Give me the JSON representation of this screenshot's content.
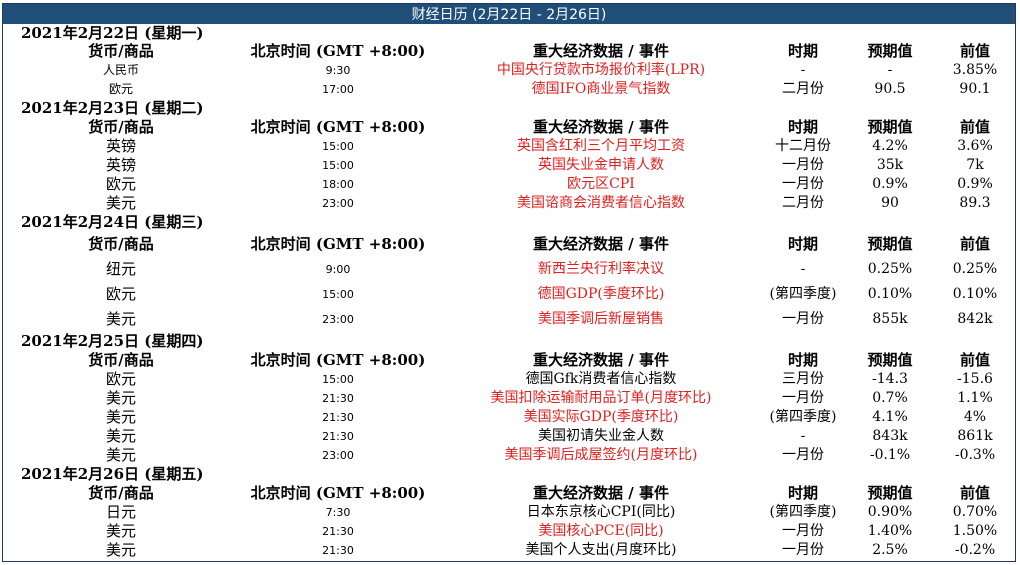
{
  "title": "财经日历 (2月22日 - 2月26日)",
  "headers": {
    "currency": "货币/商品",
    "time": "北京时间 (GMT +8:00)",
    "event": "重大经济数据 / 事件",
    "period": "时期",
    "forecast": "预期值",
    "previous": "前值"
  },
  "days": [
    {
      "date": "2021年2月22日 (星期一)",
      "rows": [
        {
          "currency": "人民币",
          "time": "9:30",
          "event": "中国央行贷款市场报价利率(LPR)",
          "period": "-",
          "forecast": "-",
          "previous": "3.85%",
          "highlight": true
        },
        {
          "currency": "欧元",
          "time": "17:00",
          "event": "德国IFO商业景气指数",
          "period": "二月份",
          "forecast": "90.5",
          "previous": "90.1",
          "highlight": true
        }
      ]
    },
    {
      "date": "2021年2月23日 (星期二)",
      "rows": [
        {
          "currency": "英镑",
          "time": "15:00",
          "event": "英国含红利三个月平均工资",
          "period": "十二月份",
          "forecast": "4.2%",
          "previous": "3.6%",
          "highlight": true
        },
        {
          "currency": "英镑",
          "time": "15:00",
          "event": "英国失业金申请人数",
          "period": "一月份",
          "forecast": "35k",
          "previous": "7k",
          "highlight": true
        },
        {
          "currency": "欧元",
          "time": "18:00",
          "event": "欧元区CPI",
          "period": "一月份",
          "forecast": "0.9%",
          "previous": "0.9%",
          "highlight": true
        },
        {
          "currency": "美元",
          "time": "23:00",
          "event": "美国谘商会消费者信心指数",
          "period": "二月份",
          "forecast": "90",
          "previous": "89.3",
          "highlight": true
        }
      ]
    },
    {
      "date": "2021年2月24日 (星期三)",
      "rows": [
        {
          "currency": "纽元",
          "time": "9:00",
          "event": "新西兰央行利率决议",
          "period": "-",
          "forecast": "0.25%",
          "previous": "0.25%",
          "highlight": true
        },
        {
          "currency": "欧元",
          "time": "15:00",
          "event": "德国GDP(季度环比)",
          "period": "(第四季度)",
          "forecast": "0.10%",
          "previous": "0.10%",
          "highlight": true
        },
        {
          "currency": "美元",
          "time": "23:00",
          "event": "美国季调后新屋销售",
          "period": "一月份",
          "forecast": "855k",
          "previous": "842k",
          "highlight": true
        }
      ]
    },
    {
      "date": "2021年2月25日 (星期四)",
      "rows": [
        {
          "currency": "欧元",
          "time": "15:00",
          "event": "德国Gfk消费者信心指数",
          "period": "三月份",
          "forecast": "-14.3",
          "previous": "-15.6",
          "highlight": false
        },
        {
          "currency": "美元",
          "time": "21:30",
          "event": "美国扣除运输耐用品订单(月度环比)",
          "period": "一月份",
          "forecast": "0.7%",
          "previous": "1.1%",
          "highlight": true
        },
        {
          "currency": "美元",
          "time": "21:30",
          "event": "美国实际GDP(季度环比)",
          "period": "(第四季度)",
          "forecast": "4.1%",
          "previous": "4%",
          "highlight": true
        },
        {
          "currency": "美元",
          "time": "21:30",
          "event": "美国初请失业金人数",
          "period": "-",
          "forecast": "843k",
          "previous": "861k",
          "highlight": false
        },
        {
          "currency": "美元",
          "time": "23:00",
          "event": "美国季调后成屋签约(月度环比)",
          "period": "一月份",
          "forecast": "-0.1%",
          "previous": "-0.3%",
          "highlight": true
        }
      ]
    },
    {
      "date": "2021年2月26日 (星期五)",
      "rows": [
        {
          "currency": "日元",
          "time": "7:30",
          "event": "日本东京核心CPI(同比)",
          "period": "(第四季度)",
          "forecast": "0.90%",
          "previous": "0.70%",
          "highlight": false
        },
        {
          "currency": "美元",
          "time": "21:30",
          "event": "美国核心PCE(同比)",
          "period": "一月份",
          "forecast": "1.40%",
          "previous": "1.50%",
          "highlight": true
        },
        {
          "currency": "美元",
          "time": "21:30",
          "event": "美国个人支出(月度环比)",
          "period": "一月份",
          "forecast": "2.5%",
          "previous": "-0.2%",
          "highlight": false
        }
      ]
    }
  ]
}
